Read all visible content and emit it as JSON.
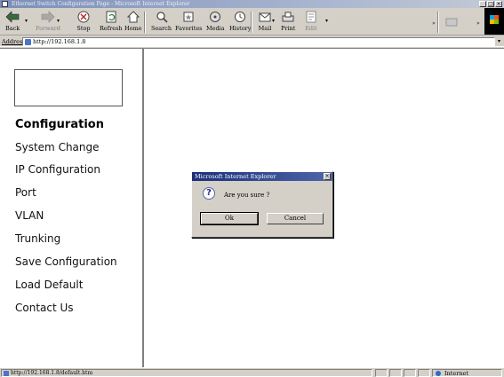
{
  "window": {
    "title": "Ethernet Switch Configuration Page - Microsoft Internet Explorer",
    "min": "_",
    "max": "□",
    "close": "×"
  },
  "toolbar": {
    "back": "Back",
    "forward": "Forward",
    "stop": "Stop",
    "refresh": "Refresh",
    "home": "Home",
    "search": "Search",
    "favorites": "Favorites",
    "media": "Media",
    "history": "History",
    "mail": "Mail",
    "print": "Print",
    "edit": "Edit"
  },
  "address": {
    "label": "Address",
    "url": "http://192.168.1.8"
  },
  "nav": {
    "heading": "Configuration",
    "items": [
      "System Change",
      "IP Configuration",
      "Port",
      "VLAN",
      "Trunking",
      "Save Configuration",
      "Load Default",
      "Contact Us"
    ]
  },
  "dialog": {
    "title": "Microsoft Internet Explorer",
    "close": "×",
    "icon": "?",
    "message": "Are you sure ?",
    "ok": "Ok",
    "cancel": "Cancel"
  },
  "status": {
    "text": "http://192.168.1.8/default.htm",
    "zone": "Internet"
  },
  "colors": {
    "chrome": "#d4d0c8",
    "dialog_title": "#1c2f7a"
  }
}
